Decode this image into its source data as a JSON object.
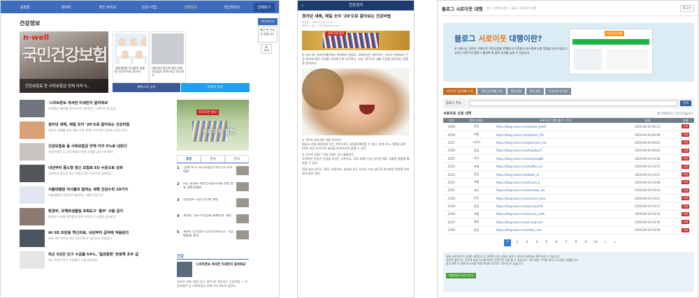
{
  "panel1": {
    "nav": [
      "실환경",
      "데이터",
      "혁신 바이오",
      "건강•기업",
      "생활정보",
      "혁신바이오",
      "전체보기"
    ],
    "active_nav": 4,
    "section_title": "건강정보",
    "side_button": "최근본기사",
    "side_box": "최근 본 기사가 없습니다",
    "side_top": "TOP",
    "hero": {
      "brand": "n·well",
      "sign": "국민건강보험",
      "caption": "건강보험료 등 사회보험금 연체 이자 5…"
    },
    "cards": [
      {
        "caption": "서울대병원 의사들의 맞춤형 건강주치의 10가지"
      },
      {
        "caption": "내년부터 중소형 갱신 보험 건강검진 54% 최근 5년 최고"
      }
    ],
    "share": {
      "facebook": "페이스북 공유",
      "twitter": "트위터 공유"
    },
    "news": [
      {
        "title": "'스마트폰보 계셔한 미세먼지 알려줘요'",
        "desc": "미세먼지 예보를 실시간으로 알려주는 스마트폰 앱 등장",
        "color": "#6f757c"
      },
      {
        "title": "겸자년 새해, 매일 숫자 '20'으로 알아보는 건강비법",
        "desc": "경자년 새해를 맞아 매일 숫자 20을 기억하면 건강에 도움이 된다",
        "color": "#d9a178"
      },
      {
        "title": "건강보험료 등 사회보험금 연체 이자 5%로 내린다",
        "desc": "건강보험료 등 사회보험료 연체 이자를 낮추기로 했다",
        "color": "#c9c3bd"
      },
      {
        "title": "내년부터 중소형 갱신 보험료 EU 수준으로 강화",
        "desc": "내년부터 중소형 갱신 보험이 EU 수준으로 강화된다",
        "color": "#53565a"
      },
      {
        "title": "서울대병원 의사들의 알려는 새해 건강수칙 10가지",
        "desc": "서울대병원 의료진이 제안하는 새해 건강수칙",
        "color": "#dfe6ee"
      },
      {
        "title": "환경부, 유해화생물질 포획도구 '돌무' 사용 금지",
        "desc": "환경부가 유해 화학물질 관련 포획도구 사용을 금지한다",
        "color": "#8a7b72"
      },
      {
        "title": "AI·3D 프린팅 혁신의료, 내년부터 급여에 적용된다",
        "desc": "AI와 3D 프린팅 기반 혁신의료가 내년부터 적용된다",
        "color": "#4a5561"
      },
      {
        "title": "최근 5년간 인구 수급률 54%, '일관증현' 한영책 초주 급",
        "desc": "최근 5년간 인구 수급률이 크게 늘어났다",
        "color": "#e6e6e6"
      }
    ],
    "ad": {
      "label": "프로모션 홍보",
      "text": "서로이웃 실천"
    },
    "rank_tabs": [
      "종합",
      "분야",
      "전국"
    ],
    "ranks": [
      {
        "num": "1",
        "text": "'상세 특가' 국가사랑공부래 인크 조작 의뢰"
      },
      {
        "num": "2",
        "text": "피곤 낮게도 대한민국정시자원 관련 항요 검토하세요"
      },
      {
        "num": "3",
        "text": "전립적서 거강 전기에 계약"
      },
      {
        "num": "4",
        "text": "계작된 '의도부리집에 내여반대' 재약"
      },
      {
        "num": "5",
        "text": "제4회 '건강청기 (건강목사하곤)' 기업 발표회 축사"
      }
    ],
    "health_block": {
      "title": "건강",
      "headline": "'스마트폰보 계셔한 미세먼지 알려줘요'",
      "desc": "경자년 새해, 매일 숫자 '20'으로 알아보는 건강비법 — 건강보험료 등 사회보험금 연체 이자 5%로 내린다"
    }
  },
  "panel2": {
    "header": "건강관리",
    "back": "‹",
    "title": "경자년 새해, 매일 숫자 '20'으로 알아보는 건강비법",
    "meta1": "작성일 : 2020.01.01 01:22",
    "meta2": "작성자 : 김○○ 기자 @idxxx.com",
    "ad_label": "프로모션 홍보",
    "body1": "한 의사 해, 경자년(庚子年) 쥐띠해가 밝았다. 2020년은 20이라는 숫자가 반복되어 건강 관리에 좋은 숫자를 기억해 두면 유익하다. 숫자 '20'으로 새해 건강을 관리하는 방법을 알아본다.",
    "caption1": "① '20'초 손씻기와 거품 유지하기",
    "body2": "평상시 손을 깨끗하게 씻는 것만으로도 감염을 예방할 수 있다. 손에 비누 거품을 내어 20초 이상 문지르면 세균을 효과적으로 없앨 수 있다.",
    "caption2": "② 규칙적 '20도' '하루 20분' 걷기 활용하기",
    "body3": "규칙적인 운동은 건강을 지키는 기본이다. 하루 20분 이상 걷기만 해도 심혈관 질환을 예방할 수 있다.",
    "body4": "적정 실내 온도는 20도 안팎이다. 실내외 온도 차이가 크지 않도록 관리하면 면역력 유지에 도움이 된다."
  },
  "panel3": {
    "title": "블로그 서로이웃 대행",
    "crumb": "홈 > 마케팅 대행 > 블로그 서로이웃 대행",
    "login": "로그인",
    "banner": {
      "title_a": "블로그 ",
      "title_b": "서로이웃",
      "title_c": " 대행이란?",
      "desc": "본 서비스는 원하는 키워드로 이웃신청을 진행해 내 이웃들의 포스팅에 신청 알림을 남겨드립니다. 오교하는 방문으로 블로그 활성화 및 홍보 효과를 높일 수 있습니다.",
      "badge": "이웃신청 대행",
      "shot_label": "blog"
    },
    "tabs": [
      "서로이웃 업무대행 소개",
      "댓글 업무대행 신청",
      "댓글 설정",
      "통계 설정",
      "주의사항 및 약관"
    ],
    "active_tab": 0,
    "search_label": "블로그 주소",
    "search_btn": "검색",
    "list_title": "서로이웃 신청 내역",
    "count": "총 25602건 / 1/13 Page(s)",
    "columns": [
      "번호",
      "검색 키워드",
      "서로이웃 진행 블로그 주소",
      "날짜",
      "삭제"
    ],
    "rows": [
      {
        "n": "2559",
        "k": "맛집",
        "u": "https://blog.naver.com/yellow_jlrb47",
        "d": "2019-06-20 00:12"
      },
      {
        "n": "2558",
        "k": "여행",
        "u": "https://blog.naver.com/kkimm_f31",
        "d": "2019-06-20 00:09"
      },
      {
        "n": "2557",
        "k": "고양이",
        "u": "https://blog.naver.com/petroom_cat",
        "d": "2019-06-20 00:05"
      },
      {
        "n": "2556",
        "k": "맛집",
        "u": "https://blog.naver.com/heydays7",
        "d": "2019-06-20 00:02"
      },
      {
        "n": "2555",
        "k": "육아",
        "u": "https://blog.naver.com/momlog82",
        "d": "2019-06-19 23:58"
      },
      {
        "n": "2554",
        "k": "카페",
        "u": "https://blog.naver.com/coffee_n3",
        "d": "2019-06-19 23:55"
      },
      {
        "n": "2553",
        "k": "맛집",
        "u": "https://blog.naver.com/bobs_ki",
        "d": "2019-06-19 23:51"
      },
      {
        "n": "2552",
        "k": "여행",
        "u": "https://blog.naver.com/travel_jj",
        "d": "2019-06-19 23:48"
      },
      {
        "n": "2551",
        "k": "뷰티",
        "u": "https://blog.naver.com/skinday_lee",
        "d": "2019-06-19 23:44"
      },
      {
        "n": "2550",
        "k": "운동",
        "u": "https://blog.naver.com/runner_park",
        "d": "2019-06-19 23:41"
      },
      {
        "n": "2549",
        "k": "맛집",
        "u": "https://blog.naver.com/yumyum0",
        "d": "2019-06-19 23:37"
      },
      {
        "n": "2548",
        "k": "여행",
        "u": "https://blog.naver.com/sunny_walk",
        "d": "2019-06-19 23:33"
      },
      {
        "n": "2547",
        "k": "캠핑",
        "u": "https://blog.naver.com/campnote",
        "d": "2019-06-19 23:30"
      },
      {
        "n": "2546",
        "k": "맛집",
        "u": "https://blog.naver.com/daily_eat",
        "d": "2019-06-19 23:26"
      }
    ],
    "delete_label": "삭제",
    "pages": [
      "1",
      "2",
      "3",
      "4",
      "5",
      "6",
      "7",
      "8",
      "9",
      "10",
      "»",
      "»"
    ],
    "notice": [
      "실제 서로이웃이 신청한 내역입니다. 정확한 신청 내역은 블로그 관리자 화면에서 확인하실 수 있습니다.",
      "내이웃 블로그는 하루에 최대 100명까지만 서로이웃 신청 할 수 있습니다. 하루 제한 수치를 초과 시 다음날 진행됩니다.",
      "업무 완료 후 결과 보고서를 엑셀 파일로 다운로드 받으실 수 있습니다."
    ],
    "excel_btn": "엑셀파일 Excel 받기"
  }
}
